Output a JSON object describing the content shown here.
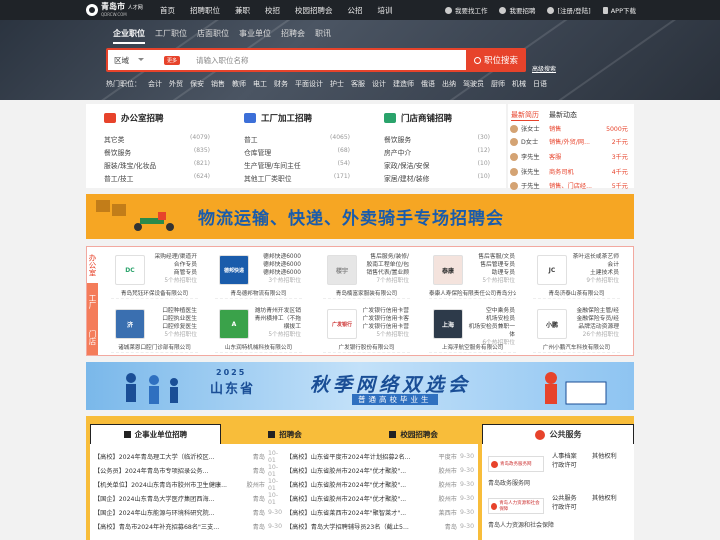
{
  "topbar": {
    "logo_text": "青岛市",
    "logo_sub": "人才网",
    "logo_domain": "QDRCW.COM",
    "nav": [
      "首页",
      "招聘职位",
      "兼职",
      "校招",
      "校园招聘会",
      "公招",
      "培训"
    ],
    "links": [
      "我要找工作",
      "我要招聘",
      "[注册/登陆]",
      "APP下载"
    ]
  },
  "hero": {
    "tabs": [
      "企业职位",
      "工厂职位",
      "店面职位",
      "事业单位",
      "招聘会",
      "职讯"
    ],
    "area_label": "区域",
    "more_badge": "更多",
    "search_placeholder": "请输入职位名称",
    "search_button": "职位搜索",
    "advanced": "高级搜索",
    "hot_label": "热门职位：",
    "hot": [
      "会计",
      "外贸",
      "保安",
      "销售",
      "教师",
      "电工",
      "财务",
      "平面设计",
      "护士",
      "客服",
      "设计",
      "建造师",
      "俄语",
      "出纳",
      "驾驶员",
      "厨师",
      "机械",
      "日语"
    ]
  },
  "categories": [
    {
      "title": "办公室招聘",
      "rows": [
        [
          "其它类",
          "(4079)"
        ],
        [
          "餐饮服务",
          "(835)"
        ],
        [
          "服装/珠宝/化妆品",
          "(821)"
        ],
        [
          "普工/技工",
          "(624)"
        ]
      ]
    },
    {
      "title": "工厂加工招聘",
      "rows": [
        [
          "普工",
          "(4065)"
        ],
        [
          "仓库管理",
          "(68)"
        ],
        [
          "生产管理/车间主任",
          "(54)"
        ],
        [
          "其他工厂类职位",
          "(171)"
        ]
      ]
    },
    {
      "title": "门店商铺招聘",
      "rows": [
        [
          "餐饮服务",
          "(30)"
        ],
        [
          "房产中介",
          "(12)"
        ],
        [
          "家政/保洁/安保",
          "(10)"
        ],
        [
          "家居/建材/装修",
          "(10)"
        ]
      ]
    }
  ],
  "newest": {
    "tabs": [
      "最新简历",
      "最新动态"
    ],
    "rows": [
      [
        "张女士",
        "销售",
        "5000元"
      ],
      [
        "D女士",
        "销售/外贸/网...",
        "2千元"
      ],
      [
        "李先生",
        "客服",
        "3千元"
      ],
      [
        "张先生",
        "商务司机",
        "4千元"
      ],
      [
        "于先生",
        "销售、门店经...",
        "5千元"
      ]
    ]
  },
  "banner1": {
    "text": "物流运输、快递、外卖骑手专场招聘会"
  },
  "employers": {
    "side": [
      "办公室",
      "工厂",
      "门店"
    ],
    "cards": [
      {
        "logo": "DC",
        "jobs": [
          "采购经理/渠道开",
          "合作专员",
          "商管专员"
        ],
        "count": "5个热招职位",
        "name": "青岛梵钰环保设备有限公司"
      },
      {
        "logo": "德邦快递",
        "jobs": [
          "德邦快递6000",
          "德邦快递6000",
          "德邦快递6000"
        ],
        "count": "3个热招职位",
        "name": "青岛德邦物流有限公司"
      },
      {
        "logo": "楼宇",
        "jobs": [
          "售后服务/装修/",
          "胶南工程单位/包",
          "销售代表/置业顾"
        ],
        "count": "7个热招职位",
        "name": "青岛楠富家服装有限公司"
      },
      {
        "logo": "泰康",
        "jobs": [
          "售后客服/文员",
          "售后管理专员",
          "助理专员"
        ],
        "count": "5个热招职位",
        "name": "泰康人寿保险有限责任公司青岛分公司"
      },
      {
        "logo": "JC",
        "jobs": [
          "茶叶运长或茶艺师",
          "会计",
          "土建技术员"
        ],
        "count": "9个热招职位",
        "name": "青岛济泰山茶有限公司"
      },
      {
        "logo": "济",
        "jobs": [
          "口腔种植医生",
          "口腔执业医生",
          "口腔修复医生"
        ],
        "count": "5个热招职位",
        "name": "诸城莱恩口腔门诊部有限公司"
      },
      {
        "logo": "A",
        "jobs": [
          "潍坊青州开发区销",
          "青州横排工（不拖",
          "横拔工"
        ],
        "count": "5个热招职位",
        "name": "山东润特机械科技有限公司"
      },
      {
        "logo": "广发银行",
        "jobs": [
          "广发银行信用卡营",
          "广发银行信用卡客",
          "广发银行信用卡营"
        ],
        "count": "5个热招职位",
        "name": "广发银行股份有限公司"
      },
      {
        "logo": "上海",
        "jobs": [
          "空中乘务员",
          "机场安检员",
          "机场安检员兼职一体"
        ],
        "count": "6个热招职位",
        "name": "上海浮航空服务有限公司"
      },
      {
        "logo": "小鹏",
        "jobs": [
          "金融保险主管/经",
          "金融保险专员/经",
          "品牌活动资源理"
        ],
        "count": "26个热招职位",
        "name": "广州小鹏汽车科技有限公司"
      }
    ]
  },
  "banner2": {
    "year": "2025",
    "province": "山东省",
    "title": "秋季网络双选会",
    "sub": "普通高校毕业生"
  },
  "section": {
    "tabs": [
      "企事业单位招聘",
      "招聘会",
      "校园招聘会"
    ],
    "news_left": [
      [
        "【高校】2024年青岛理工大学（临沂校区...",
        "青岛",
        "10-01"
      ],
      [
        "【公务员】2024年青岛市专项招录公务...",
        "青岛",
        "10-01"
      ],
      [
        "【机关单位】2024山东青岛市胶州市卫生健康...",
        "胶州市",
        "10-01"
      ],
      [
        "【国企】2024山东青岛大学医疗集团西海...",
        "青岛",
        "10-01"
      ],
      [
        "【国企】2024年山东能源与环境科研究院...",
        "青岛",
        "9-30"
      ],
      [
        "【高校】青岛市2024年补充招募68名\"三支...",
        "青岛",
        "9-30"
      ]
    ],
    "news_right": [
      [
        "【高校】山东省平度市2024年计划招募2名...",
        "平度市",
        "9-30"
      ],
      [
        "【高校】山东省胶州市2024年\"优才聚胶\"...",
        "胶州市",
        "9-30"
      ],
      [
        "【高校】山东省胶州市2024年\"优才聚胶\"...",
        "胶州市",
        "9-30"
      ],
      [
        "【高校】山东省胶州市2024年\"优才聚胶\"...",
        "胶州市",
        "9-30"
      ],
      [
        "【高校】山东省莱西市2024年\"聚智莱才\"...",
        "莱西市",
        "9-30"
      ],
      [
        "【高校】青岛大学招聘辅导员23名（截止5...",
        "青岛",
        "9-30"
      ]
    ],
    "public": {
      "title": "公共服务",
      "items": [
        {
          "img": "青岛政务服务网",
          "text1": "人事档案",
          "text2": "其他权利",
          "text3": "行政许可",
          "caption": "青岛政务服务网"
        },
        {
          "img": "青岛人力资源和社会保障",
          "text1": "公共服务",
          "text2": "其他权利",
          "text3": "行政许可",
          "caption": "青岛人力资源和社会保障"
        }
      ]
    }
  }
}
